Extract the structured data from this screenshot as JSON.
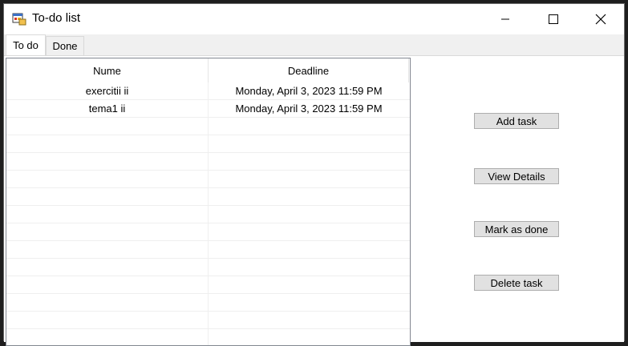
{
  "window": {
    "title": "To-do list"
  },
  "tabs": [
    {
      "label": "To do",
      "active": true
    },
    {
      "label": "Done",
      "active": false
    }
  ],
  "listview": {
    "columns": [
      "Nume",
      "Deadline"
    ],
    "rows": [
      {
        "nume": "exercitii ii",
        "deadline": "Monday, April 3, 2023 11:59 PM"
      },
      {
        "nume": "tema1 ii",
        "deadline": "Monday, April 3, 2023 11:59 PM"
      }
    ]
  },
  "buttons": {
    "add_task": "Add task",
    "view_details": "View Details",
    "mark_done": "Mark as done",
    "delete_task": "Delete task"
  }
}
